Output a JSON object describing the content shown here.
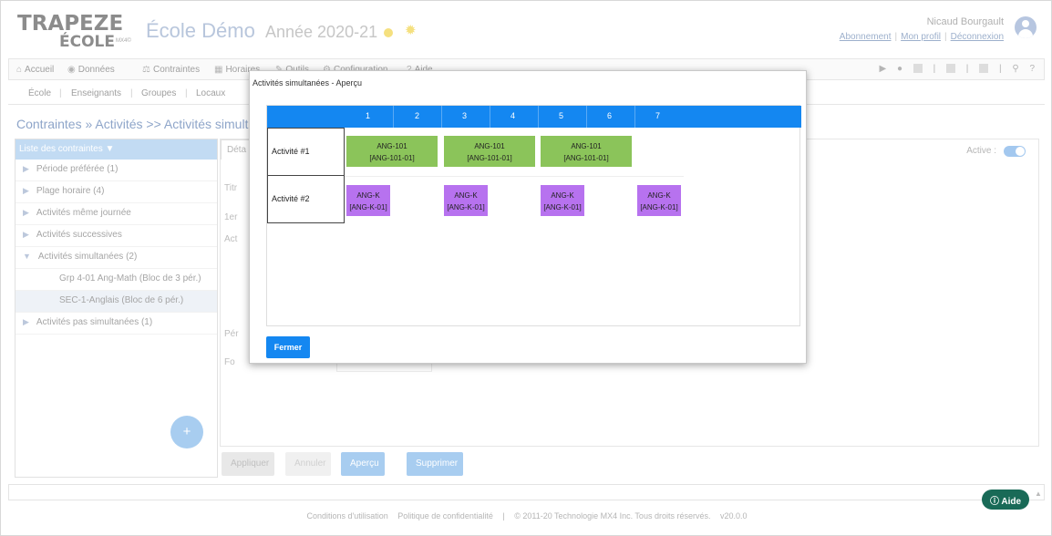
{
  "header": {
    "logo_line1": "TRAPEZE",
    "logo_line2": "ÉCOLE",
    "logo_tag": "MX4©",
    "school": "École Démo",
    "year": "Année 2020-21",
    "user_name": "Nicaud Bourgault",
    "links": [
      "Abonnement",
      "Mon profil",
      "Déconnexion"
    ]
  },
  "menu": {
    "items": [
      {
        "label": "Accueil",
        "icon": "home-icon"
      },
      {
        "label": "Données",
        "icon": "database-icon"
      },
      {
        "label": "Contraintes",
        "icon": "constraint-icon"
      },
      {
        "label": "Horaires",
        "icon": "calendar-icon"
      },
      {
        "label": "Outils",
        "icon": "tools-icon"
      },
      {
        "label": "Configuration",
        "icon": "gear-icon"
      },
      {
        "label": "Aide",
        "icon": "help-icon"
      }
    ]
  },
  "submenu": [
    "École",
    "Enseignants",
    "Groupes",
    "Locaux"
  ],
  "breadcrumb": "Contraintes » Activités >> Activités simultanées",
  "left_panel": {
    "header": "Liste des contraintes",
    "items": [
      {
        "label": "Période préférée (1)"
      },
      {
        "label": "Plage horaire (4)"
      },
      {
        "label": "Activités même journée"
      },
      {
        "label": "Activités successives"
      },
      {
        "label": "Activités simultanées (2)"
      }
    ],
    "sub_items": [
      {
        "label": "Grp 4-01 Ang-Math (Bloc de 3 pér.)"
      },
      {
        "label": "SEC-1-Anglais (Bloc de 6 pér.)"
      }
    ],
    "last_item": "Activités pas simultanées (1)",
    "add_symbol": "+"
  },
  "detail": {
    "tab": "Déta",
    "active_label": "Active :",
    "field_labels": [
      "Titr",
      "1er",
      "Act",
      "Pér",
      "Fo"
    ]
  },
  "buttons": {
    "apply": "Appliquer",
    "cancel": "Annuler",
    "preview": "Aperçu",
    "delete": "Supprimer"
  },
  "footer": {
    "terms": "Conditions d'utilisation",
    "privacy": "Politique de confidentialité",
    "copyright": "© 2011-20 Technologie MX4 Inc. Tous droits réservés.",
    "version": "v20.0.0",
    "help": "Aide"
  },
  "modal": {
    "title": "Activités simultanées - Aperçu",
    "periods": [
      "1",
      "2",
      "3",
      "4",
      "5",
      "6",
      "7"
    ],
    "rows": [
      {
        "label": "Activité #1",
        "blocks": [
          {
            "line1": "ANG-101",
            "line2": "[ANG-101-01]"
          },
          {
            "line1": "ANG-101",
            "line2": "[ANG-101-01]"
          },
          {
            "line1": "ANG-101",
            "line2": "[ANG-101-01]"
          }
        ]
      },
      {
        "label": "Activité #2",
        "blocks": [
          {
            "line1": "ANG-K",
            "line2": "[ANG-K-01]"
          },
          {
            "line1": "ANG-K",
            "line2": "[ANG-K-01]"
          },
          {
            "line1": "ANG-K",
            "line2": "[ANG-K-01]"
          },
          {
            "line1": "ANG-K",
            "line2": "[ANG-K-01]"
          }
        ]
      }
    ],
    "close": "Fermer",
    "colors": {
      "header": "#1487f1",
      "activity1": "#8bc45a",
      "activity2": "#b772ef"
    }
  }
}
